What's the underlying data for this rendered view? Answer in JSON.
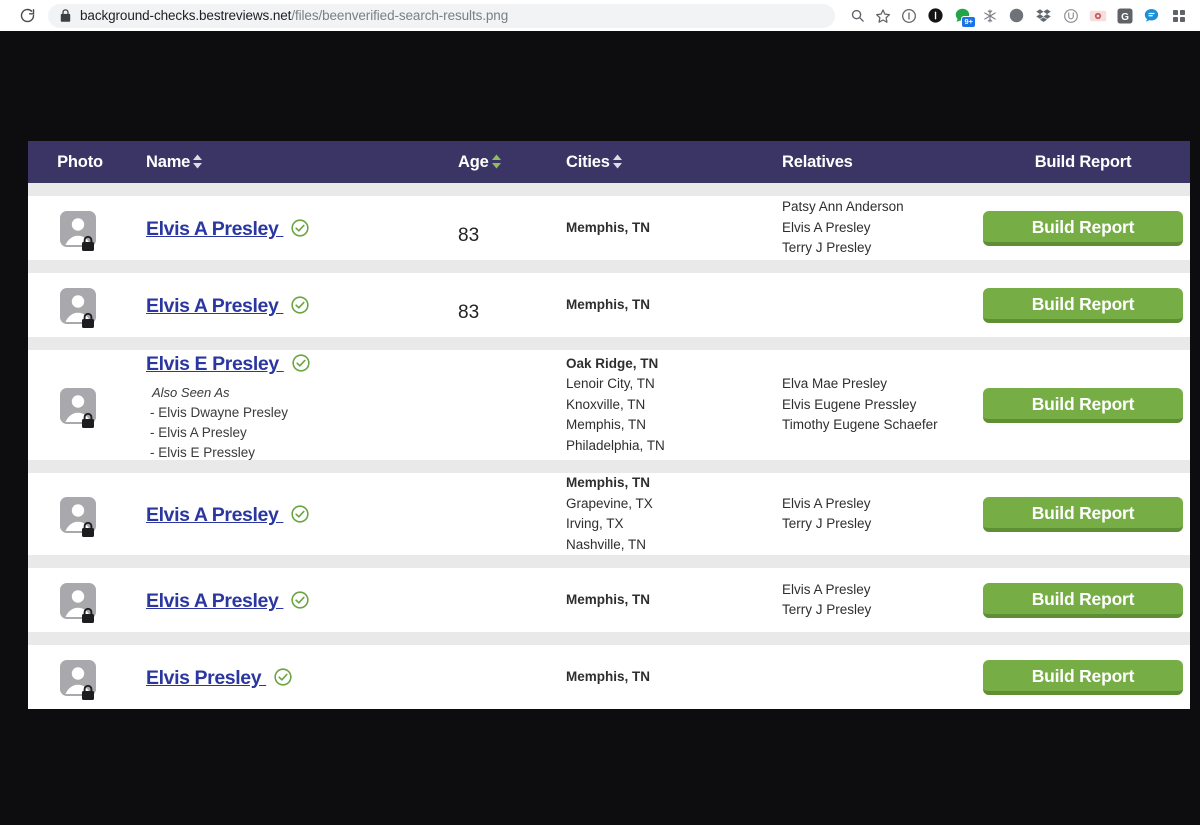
{
  "browser": {
    "reload_icon": "reload-icon",
    "lock_icon": "lock-icon",
    "url_domain": "background-checks.bestreviews.net",
    "url_path": "/files/beenverified-search-results.png",
    "omnibox_actions": [
      "search-icon",
      "bookmark-star-icon"
    ],
    "extensions": [
      {
        "name": "info-circle-icon"
      },
      {
        "name": "dark-circle-one-icon"
      },
      {
        "name": "green-bubble-icon",
        "badge": "9+"
      },
      {
        "name": "snowflake-icon"
      },
      {
        "name": "moon-circle-icon"
      },
      {
        "name": "dropbox-icon"
      },
      {
        "name": "shield-u-icon"
      },
      {
        "name": "camera-pink-icon"
      },
      {
        "name": "grammarly-g-icon"
      },
      {
        "name": "blue-chat-icon"
      },
      {
        "name": "extensions-grid-icon"
      }
    ]
  },
  "table": {
    "columns": [
      {
        "key": "photo",
        "label": "Photo",
        "sortable": false
      },
      {
        "key": "name",
        "label": "Name",
        "sortable": true,
        "sort_state": "none"
      },
      {
        "key": "age",
        "label": "Age",
        "sortable": true,
        "sort_state": "active"
      },
      {
        "key": "cities",
        "label": "Cities",
        "sortable": true,
        "sort_state": "none"
      },
      {
        "key": "relatives",
        "label": "Relatives",
        "sortable": false
      },
      {
        "key": "build",
        "label": "Build Report",
        "sortable": false
      }
    ],
    "build_button_label": "Build Report",
    "aka_label": "Also Seen As",
    "rows": [
      {
        "name": "Elvis A Presley",
        "verified": true,
        "age": "83",
        "aka": [],
        "cities": [
          "Memphis, TN"
        ],
        "relatives": [
          "Patsy Ann Anderson",
          "Elvis A Presley",
          "Terry J Presley"
        ]
      },
      {
        "name": "Elvis A Presley",
        "verified": true,
        "age": "83",
        "aka": [],
        "cities": [
          "Memphis, TN"
        ],
        "relatives": []
      },
      {
        "name": "Elvis E Presley",
        "verified": true,
        "age": "",
        "aka": [
          "- Elvis Dwayne Presley",
          "- Elvis A Presley",
          "- Elvis E Pressley"
        ],
        "cities": [
          "Oak Ridge, TN",
          "Lenoir City, TN",
          "Knoxville, TN",
          "Memphis, TN",
          "Philadelphia, TN"
        ],
        "relatives": [
          "Elva Mae Presley",
          "Elvis Eugene Pressley",
          "Timothy Eugene Schaefer"
        ]
      },
      {
        "name": "Elvis A Presley",
        "verified": true,
        "age": "",
        "aka": [],
        "cities": [
          "Memphis, TN",
          "Grapevine, TX",
          "Irving, TX",
          "Nashville, TN"
        ],
        "relatives": [
          "Elvis A Presley",
          "Terry J Presley"
        ]
      },
      {
        "name": "Elvis A Presley",
        "verified": true,
        "age": "",
        "aka": [],
        "cities": [
          "Memphis, TN"
        ],
        "relatives": [
          "Elvis A Presley",
          "Terry J Presley"
        ]
      },
      {
        "name": "Elvis Presley",
        "verified": true,
        "age": "",
        "aka": [],
        "cities": [
          "Memphis, TN"
        ],
        "relatives": []
      }
    ]
  },
  "colors": {
    "header_bg": "#3b3566",
    "link": "#2b37a0",
    "button_green": "#76ad45",
    "button_green_dark": "#5e8f35",
    "verified_green": "#6aa542",
    "page_backdrop": "#0d0d0f",
    "row_gap": "#e9e9e9"
  }
}
